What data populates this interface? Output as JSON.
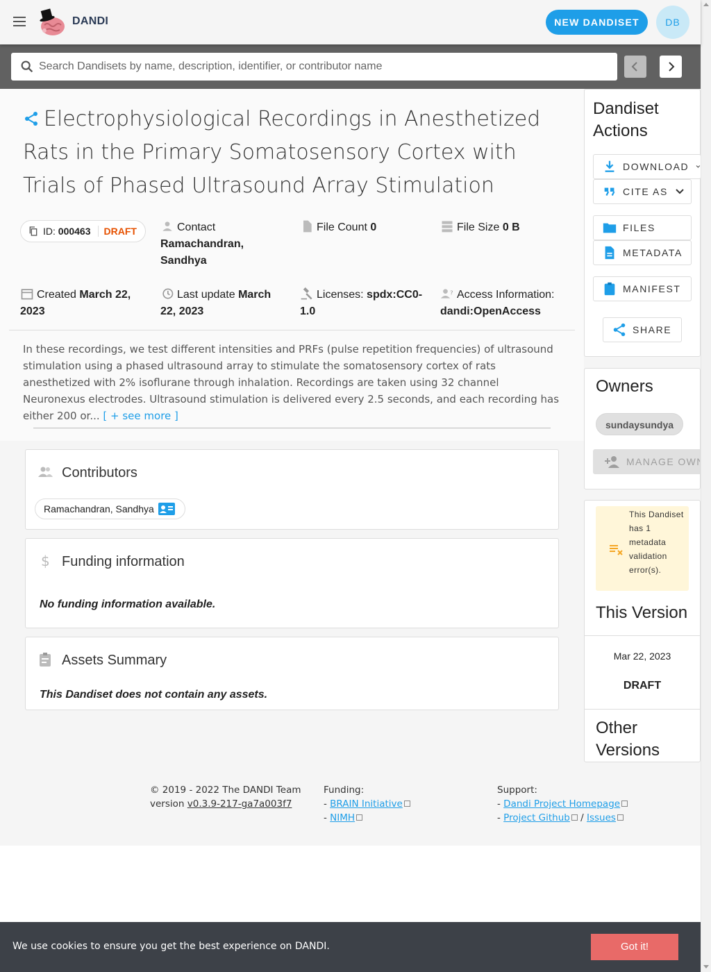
{
  "header": {
    "brand": "DANDI",
    "new_button": "NEW DANDISET",
    "avatar_initials": "DB"
  },
  "search": {
    "placeholder": "Search Dandisets by name, description, identifier, or contributor name",
    "value": ""
  },
  "dandiset": {
    "title": "Electrophysiological Recordings in Anesthetized Rats in the Primary Somatosensory Cortex with Trials of Phased Ultrasound Array Stimulation",
    "id_label": "ID:",
    "id": "000463",
    "status": "DRAFT",
    "contact_label": "Contact",
    "contact": "Ramachandran, Sandhya",
    "file_count_label": "File Count",
    "file_count": "0",
    "file_size_label": "File Size",
    "file_size": "0 B",
    "created_label": "Created",
    "created": "March 22, 2023",
    "updated_label": "Last update",
    "updated": "March 22, 2023",
    "licenses_label": "Licenses:",
    "licenses": "spdx:CC0-1.0",
    "access_label": "Access Information:",
    "access": "dandi:OpenAccess",
    "description": "In these recordings, we test different intensities and PRFs (pulse repetition frequencies) of ultrasound stimulation using a phased ultrasound array to stimulate the somatosensory cortex of rats anesthetized with 2% isoflurane through inhalation. Recordings are taken using 32 channel Neuronexus electrodes. Ultrasound stimulation is delivered every 2.5 seconds, and each recording has either 200 or...",
    "see_more": "[ + see more ]"
  },
  "cards": {
    "contributors_title": "Contributors",
    "contributor_name": "Ramachandran, Sandhya",
    "funding_title": "Funding information",
    "funding_note": "No funding information available.",
    "assets_title": "Assets Summary",
    "assets_note": "This Dandiset does not contain any assets."
  },
  "sidebar": {
    "actions_title": "Dandiset Actions",
    "download": "DOWNLOAD",
    "cite_as": "CITE AS",
    "files": "FILES",
    "metadata": "METADATA",
    "manifest": "MANIFEST",
    "share": "SHARE",
    "owners_title": "Owners",
    "owner": "sundaysundya",
    "manage_owners": "MANAGE OWNERS",
    "validation_warning": "This Dandiset has 1 metadata validation error(s).",
    "this_version_title": "This Version",
    "version_date": "Mar 22, 2023",
    "version_label": "DRAFT",
    "other_versions_title": "Other Versions"
  },
  "footer": {
    "copyright": "© 2019 - 2022 The DANDI Team",
    "version_prefix": "version",
    "version": "v0.3.9-217-ga7a003f7",
    "funding_label": "Funding:",
    "funding_links": [
      "BRAIN Initiative",
      "NIMH"
    ],
    "support_label": "Support:",
    "support_home": "Dandi Project Homepage",
    "support_github": "Project Github",
    "support_sep": "/",
    "support_issues": "Issues"
  },
  "cookie": {
    "message": "We use cookies to ensure you get the best experience on DANDI.",
    "button": "Got it!"
  },
  "colors": {
    "primary": "#1e9ee8",
    "draft": "#e65100",
    "warning_bg": "#fff6d9",
    "cookie_bg": "#3d4148",
    "cookie_btn": "#e86a68"
  }
}
